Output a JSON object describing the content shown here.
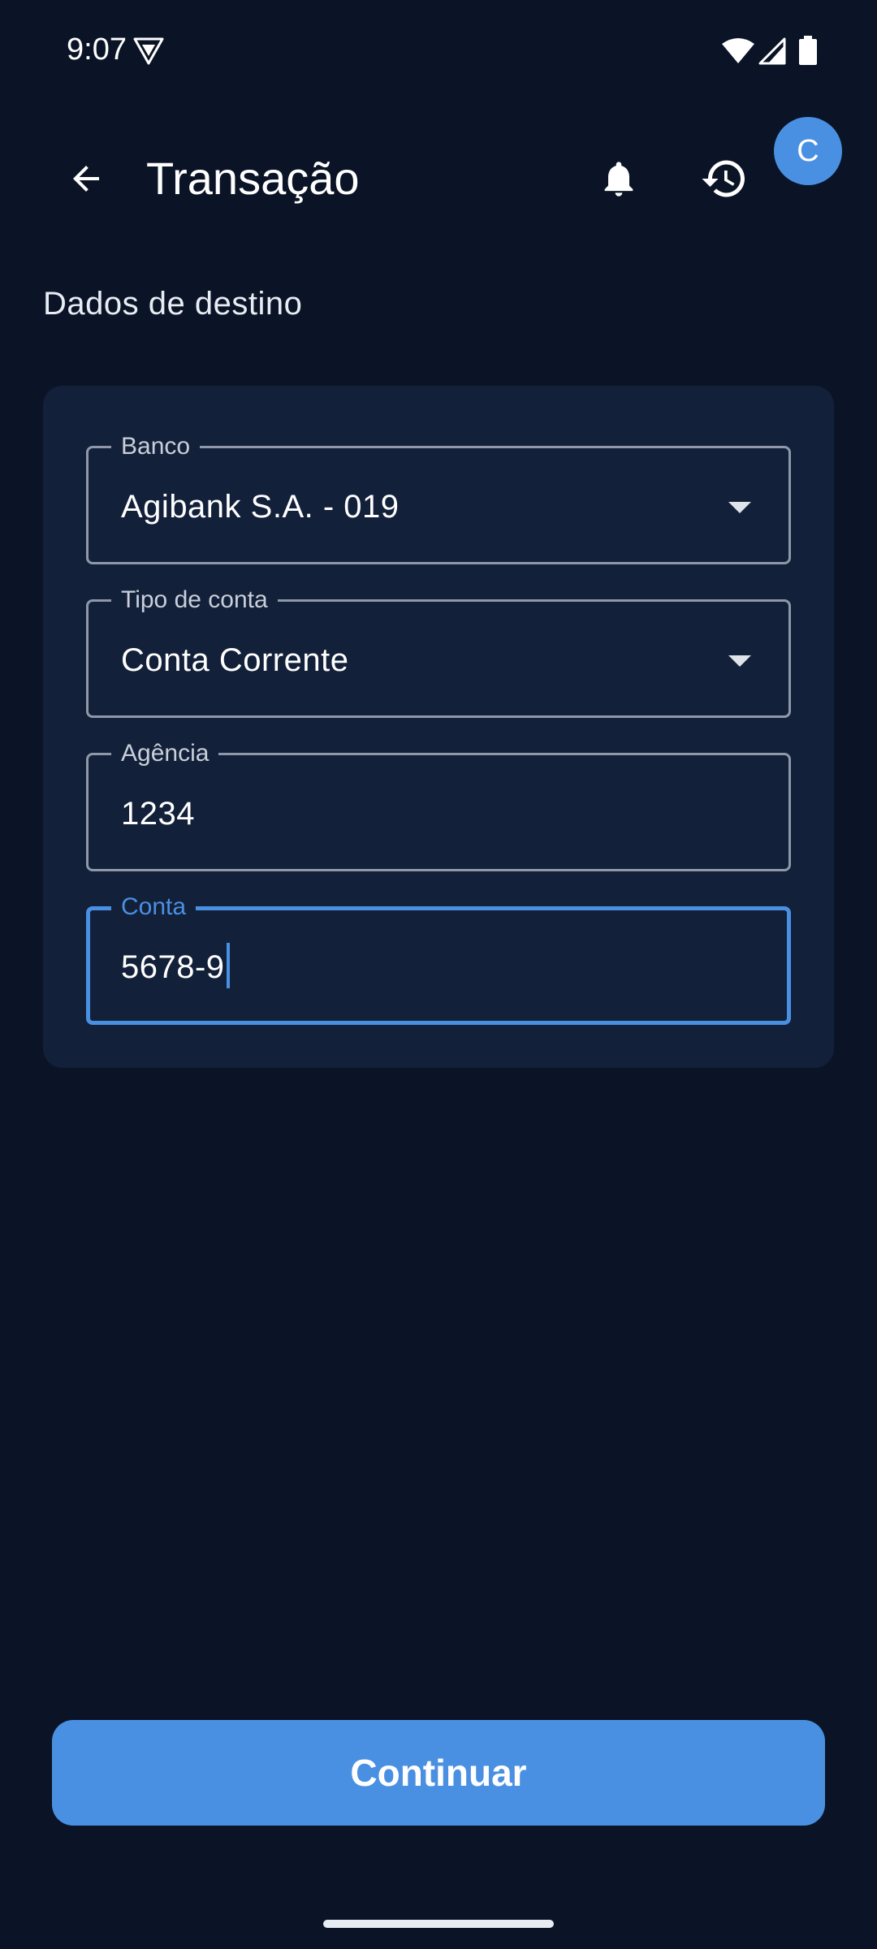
{
  "status_bar": {
    "time": "9:07",
    "icons": [
      "vpn-icon",
      "wifi-icon",
      "signal-icon",
      "battery-icon"
    ]
  },
  "app_bar": {
    "title": "Transação",
    "back_icon": "arrow-left-icon",
    "actions": [
      "bell-icon",
      "history-icon"
    ],
    "avatar_initial": "C"
  },
  "section": {
    "title": "Dados de destino"
  },
  "form": {
    "bank": {
      "label": "Banco",
      "value": "Agibank S.A. - 019"
    },
    "account_type": {
      "label": "Tipo de conta",
      "value": "Conta Corrente"
    },
    "agency": {
      "label": "Agência",
      "value": "1234"
    },
    "account": {
      "label": "Conta",
      "value": "5678-9"
    }
  },
  "actions": {
    "continue_label": "Continuar"
  },
  "colors": {
    "background": "#0b1426",
    "card": "#13203a",
    "accent": "#4a90e2",
    "field_border": "#8f98a8"
  }
}
